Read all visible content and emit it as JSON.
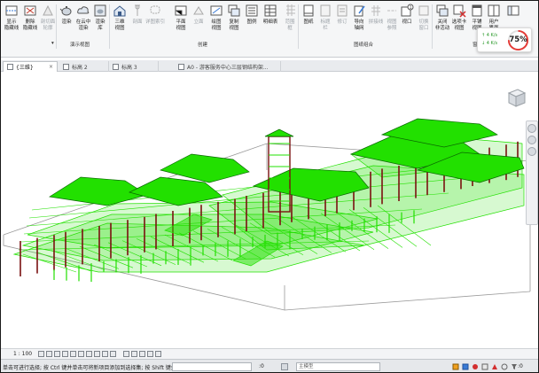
{
  "ribbon": {
    "tools": [
      {
        "id": "show-hidden",
        "label": "显示\n隐藏线"
      },
      {
        "id": "remove-hidden",
        "label": "删除\n隐藏线"
      },
      {
        "id": "cut-profile",
        "label": "剖切面\n轮廓"
      },
      {
        "id": "render",
        "label": "渲染"
      },
      {
        "id": "render-cloud",
        "label": "在云中\n渲染"
      },
      {
        "id": "render-gallery",
        "label": "渲染\n库"
      },
      {
        "id": "3d-view",
        "label": "三维\n视图"
      },
      {
        "id": "section",
        "label": "剖面"
      },
      {
        "id": "callout",
        "label": "详图索引"
      },
      {
        "id": "plan-views",
        "label": "平面\n视图"
      },
      {
        "id": "elevation",
        "label": "立面"
      },
      {
        "id": "drafting-view",
        "label": "绘图\n视图"
      },
      {
        "id": "duplicate-view",
        "label": "复制\n视图"
      },
      {
        "id": "legends",
        "label": "图例"
      },
      {
        "id": "schedules",
        "label": "明细表"
      },
      {
        "id": "scope-box",
        "label": "范围\n框"
      },
      {
        "id": "sheet",
        "label": "图纸"
      },
      {
        "id": "title-block",
        "label": "标题\n栏"
      },
      {
        "id": "revisions",
        "label": "修订"
      },
      {
        "id": "guide-grid",
        "label": "导向\n轴网"
      },
      {
        "id": "matchline",
        "label": "拼接线"
      },
      {
        "id": "view-reference",
        "label": "视图\n参照"
      },
      {
        "id": "viewports",
        "label": "视口"
      },
      {
        "id": "switch-windows",
        "label": "切换\n窗口"
      },
      {
        "id": "close-inactive",
        "label": "关闭\n非活动"
      },
      {
        "id": "tab-views",
        "label": "选项卡\n视图"
      },
      {
        "id": "tile-views",
        "label": "平铺\n视图"
      },
      {
        "id": "user-interface",
        "label": "用户\n界面"
      }
    ],
    "groups": [
      {
        "id": "presentation",
        "label": "演示视图"
      },
      {
        "id": "create",
        "label": "创建"
      },
      {
        "id": "sheet-composition",
        "label": "图纸组合"
      },
      {
        "id": "windows",
        "label": "窗口"
      }
    ],
    "group_marker": "▾"
  },
  "perf_widget": {
    "line1": "↑ 4  K/s",
    "line2": "↓ 4  K/s",
    "percent": "75%",
    "ring_value": 0.75,
    "ring_color": "#e53935"
  },
  "tabs": [
    {
      "label": "{三维}",
      "active": true
    },
    {
      "label": "标高 2",
      "active": false
    },
    {
      "label": "标高 3",
      "active": false
    },
    {
      "label": "A0 - 游客服务中心三层钢结构架...",
      "active": false
    }
  ],
  "view_bar": {
    "scale": "1 : 100"
  },
  "status_bar": {
    "hint": "单击可进行选择; 按 Ctrl 键并单击可将新项目添加到选择集; 按 Shift 键并单击可",
    "coord": ":0",
    "model": "主模型",
    "filter_count": ":0"
  },
  "colors": {
    "accent_green": "#22e000",
    "column_red": "#7a1010",
    "frame_line": "#9a9a9a"
  }
}
